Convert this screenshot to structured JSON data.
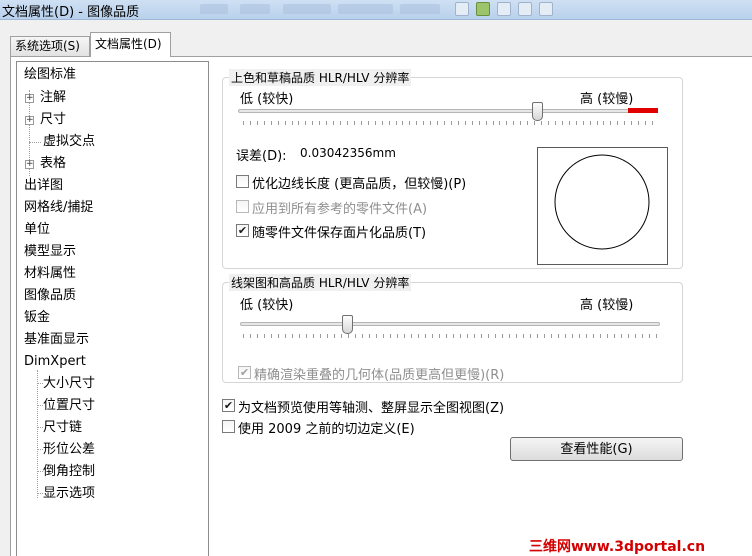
{
  "window": {
    "title": "文档属性(D) - 图像品质"
  },
  "tabs": [
    {
      "label": "系统选项(S)"
    },
    {
      "label": "文档属性(D)"
    }
  ],
  "tree": {
    "items": [
      {
        "label": "绘图标准"
      },
      {
        "label": "注解"
      },
      {
        "label": "尺寸"
      },
      {
        "label": "虚拟交点"
      },
      {
        "label": "表格"
      },
      {
        "label": "出详图"
      },
      {
        "label": "网格线/捕捉"
      },
      {
        "label": "单位"
      },
      {
        "label": "模型显示"
      },
      {
        "label": "材料属性"
      },
      {
        "label": "图像品质"
      },
      {
        "label": "钣金"
      },
      {
        "label": "基准面显示"
      },
      {
        "label": "DimXpert"
      },
      {
        "label": "大小尺寸"
      },
      {
        "label": "位置尺寸"
      },
      {
        "label": "尺寸链"
      },
      {
        "label": "形位公差"
      },
      {
        "label": "倒角控制"
      },
      {
        "label": "显示选项"
      }
    ]
  },
  "shaded": {
    "title": "上色和草稿品质 HLR/HLV 分辨率",
    "low_label": "低 (较快)",
    "high_label": "高 (较慢)",
    "slider_value": 0.72,
    "deviation_label": "误差(D):",
    "deviation_value": "0.03042356mm",
    "optimize_label": "优化边线长度 (更高品质，但较慢)(P)",
    "optimize_checked": false,
    "apply_label": "应用到所有参考的零件文件(A)",
    "apply_checked": false,
    "save_label": "随零件文件保存面片化品质(T)",
    "save_checked": true,
    "accent_color": "#e00000"
  },
  "wireframe": {
    "title": "线架图和高品质 HLR/HLV 分辨率",
    "low_label": "低 (较快)",
    "high_label": "高 (较慢)",
    "slider_value": 0.25,
    "precise_label": "精确渲染重叠的几何体(品质更高但更慢)(R)",
    "precise_checked": true
  },
  "options": {
    "iso_label": "为文档预览使用等轴测、整屏显示全图视图(Z)",
    "iso_checked": true,
    "tangent_label": "使用 2009 之前的切边定义(E)",
    "tangent_checked": false
  },
  "button": {
    "label": "查看性能(G)"
  },
  "watermark": "三维网www.3dportal.cn"
}
